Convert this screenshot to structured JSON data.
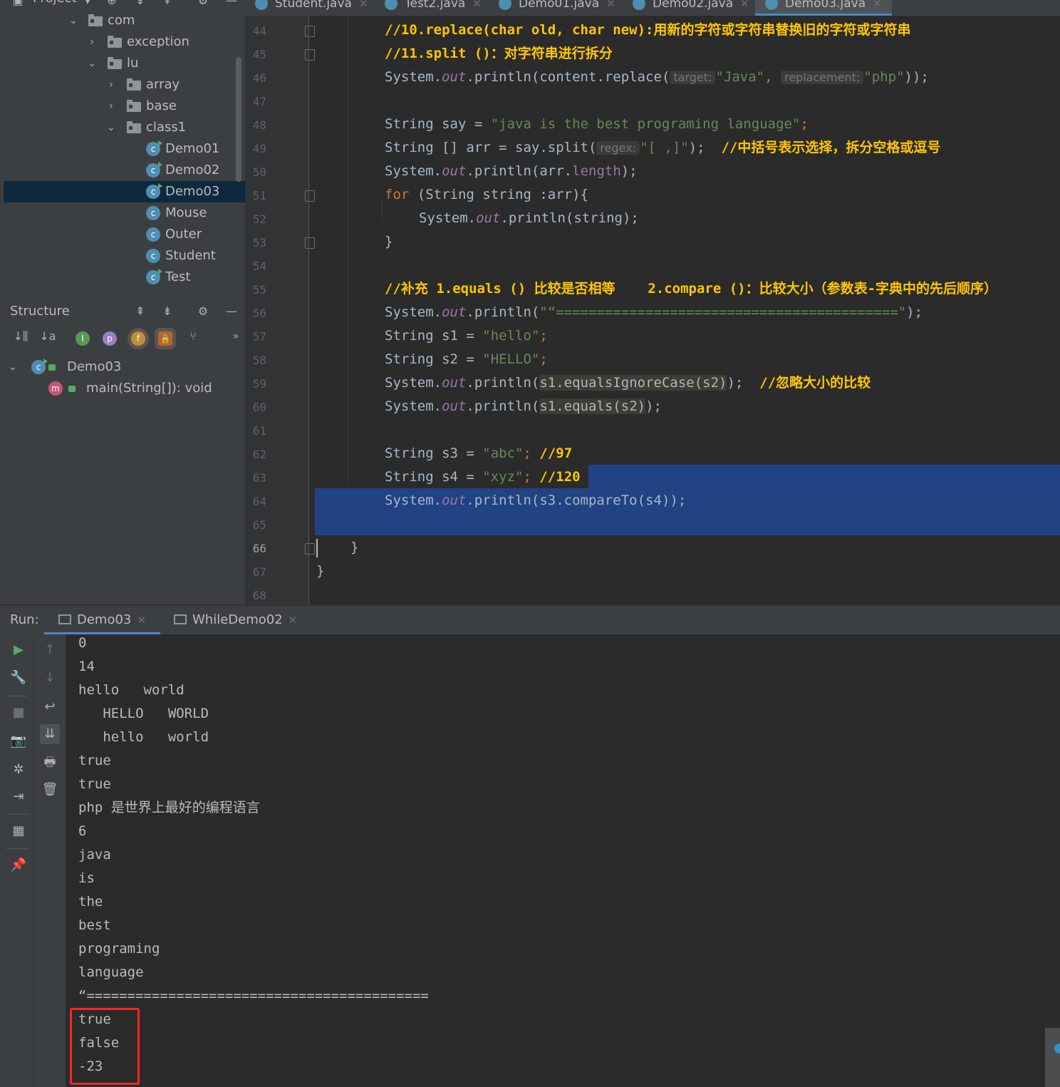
{
  "project": {
    "title": "Project",
    "tree": [
      {
        "label": "com",
        "kind": "folder",
        "expanded": true,
        "depth": 0
      },
      {
        "label": "exception",
        "kind": "folder",
        "expanded": false,
        "depth": 1
      },
      {
        "label": "lu",
        "kind": "folder",
        "expanded": true,
        "depth": 1
      },
      {
        "label": "array",
        "kind": "folder",
        "expanded": false,
        "depth": 2
      },
      {
        "label": "base",
        "kind": "folder",
        "expanded": false,
        "depth": 2
      },
      {
        "label": "class1",
        "kind": "folder",
        "expanded": true,
        "depth": 2
      },
      {
        "label": "Demo01",
        "kind": "class-run",
        "depth": 3
      },
      {
        "label": "Demo02",
        "kind": "class-run",
        "depth": 3
      },
      {
        "label": "Demo03",
        "kind": "class-run",
        "depth": 3,
        "selected": true
      },
      {
        "label": "Mouse",
        "kind": "class",
        "depth": 3
      },
      {
        "label": "Outer",
        "kind": "class",
        "depth": 3
      },
      {
        "label": "Student",
        "kind": "class",
        "depth": 3
      },
      {
        "label": "Test",
        "kind": "class-run",
        "depth": 3
      }
    ]
  },
  "structure": {
    "title": "Structure",
    "class_name": "Demo03",
    "method": "main(String[]): void",
    "badges": {
      "i": "I",
      "p": "p",
      "f": "f",
      "m": "m"
    }
  },
  "tabs": [
    {
      "label": "Student.java",
      "active": false
    },
    {
      "label": "Test2.java",
      "active": false
    },
    {
      "label": "Demo01.java",
      "active": false
    },
    {
      "label": "Demo02.java",
      "active": false
    },
    {
      "label": "Demo03.java",
      "active": true
    }
  ],
  "editor": {
    "line_numbers": [
      "44",
      "45",
      "46",
      "47",
      "48",
      "49",
      "50",
      "51",
      "52",
      "53",
      "54",
      "55",
      "56",
      "57",
      "58",
      "59",
      "60",
      "61",
      "62",
      "63",
      "64",
      "65",
      "66",
      "67",
      "68"
    ],
    "current_line": "66",
    "code": {
      "l44": "//10.replace(char old, char new):用新的字符或字符串替换旧的字符或字符串",
      "l45": "//11.split ()：对字符串进行拆分",
      "l46_a": "System.",
      "l46_b": "out",
      "l46_c": ".println(content.replace(",
      "l46_hint1": "target:",
      "l46_s1": "\"Java\"",
      "l46_comma": ",",
      "l46_hint2": "replacement:",
      "l46_s2": "\"php\"",
      "l46_end": "));",
      "l48_a": "String say = ",
      "l48_s": "\"java is the best programing language\"",
      "l48_end": ";",
      "l49_a": "String [] arr = say.split(",
      "l49_hint": "regex:",
      "l49_s": "\"[ ,]\"",
      "l49_end": ");",
      "l49_cmt": "//中括号表示选择，拆分空格或逗号",
      "l50_a": "System.",
      "l50_b": "out",
      "l50_c": ".println(arr.",
      "l50_d": "length",
      "l50_end": ");",
      "l51_kw": "for",
      "l51_rest": " (String string :arr){",
      "l52_a": "System.",
      "l52_b": "out",
      "l52_c": ".println(string);",
      "l53": "}",
      "l55": "//补充 1.equals () 比较是否相等    2.compare ()：比较大小（参数表-字典中的先后顺序）",
      "l56_a": "System.",
      "l56_b": "out",
      "l56_c": ".println(",
      "l56_s": "\"“==========================================\"",
      "l56_end": ");",
      "l57_a": "String s1 = ",
      "l57_s": "\"hello\"",
      "l57_end": ";",
      "l58_a": "String s2 = ",
      "l58_s": "\"HELLO\"",
      "l58_end": ";",
      "l59_a": "System.",
      "l59_b": "out",
      "l59_c": ".println(",
      "l59_hl": "s1.equalsIgnoreCase(s2)",
      "l59_end": ");",
      "l59_cmt": "//忽略大小的比较",
      "l60_a": "System.",
      "l60_b": "out",
      "l60_c": ".println(",
      "l60_hl": "s1.equals(s2)",
      "l60_end": ");",
      "l62_a": "String s3 = ",
      "l62_s": "\"abc\"",
      "l62_semi": ";",
      "l62_cmt": "//97",
      "l63_a": "String s4 = ",
      "l63_s": "\"xyz\"",
      "l63_semi": ";",
      "l63_cmt": "//120",
      "l64_a": "System.",
      "l64_b": "out",
      "l64_c": ".println(s3.compareTo(s4));",
      "l66": "}",
      "l67": "}"
    }
  },
  "run": {
    "label": "Run:",
    "tabs": [
      {
        "label": "Demo03",
        "active": true
      },
      {
        "label": "WhileDemo02",
        "active": false
      }
    ],
    "output": [
      "0",
      "14",
      "hello   world",
      "   HELLO   WORLD",
      "   hello   world",
      "true",
      "true",
      "php 是世界上最好的编程语言",
      "6",
      "java",
      "is",
      "the",
      "best",
      "programing",
      "language",
      "“==========================================",
      "true",
      "false",
      "-23"
    ]
  },
  "colors": {
    "keyword": "#cc7832",
    "string": "#6a8759",
    "field": "#9876aa",
    "comment_highlight": "#ffc600",
    "selection": "#214283",
    "annotation_box": "#ff2424"
  }
}
